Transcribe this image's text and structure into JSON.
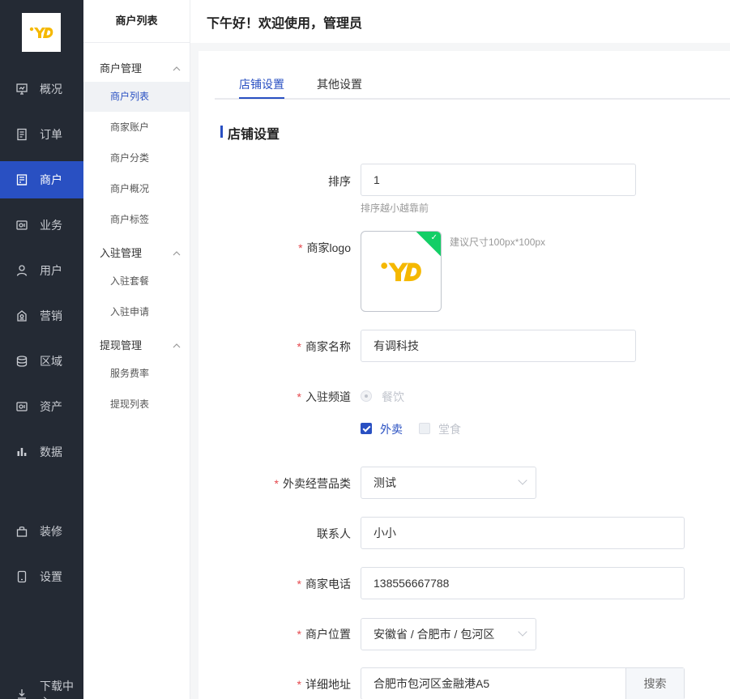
{
  "brand": {
    "logo_text": "YD",
    "accent": "#2950c2",
    "logo_color": "#f5b800"
  },
  "sidebar": {
    "items": [
      {
        "label": "概况",
        "icon": "dashboard-icon"
      },
      {
        "label": "订单",
        "icon": "order-icon"
      },
      {
        "label": "商户",
        "icon": "store-icon",
        "active": true
      },
      {
        "label": "业务",
        "icon": "business-icon"
      },
      {
        "label": "用户",
        "icon": "user-icon"
      },
      {
        "label": "营销",
        "icon": "marketing-icon"
      },
      {
        "label": "区域",
        "icon": "region-icon"
      },
      {
        "label": "资产",
        "icon": "asset-icon"
      },
      {
        "label": "数据",
        "icon": "data-icon"
      },
      {
        "label": "装修",
        "icon": "decoration-icon"
      },
      {
        "label": "设置",
        "icon": "settings-icon"
      }
    ],
    "bottom_partial": "下载中心"
  },
  "subbar": {
    "title": "商户列表",
    "groups": [
      {
        "title": "商户管理",
        "items": [
          "商户列表",
          "商家账户",
          "商户分类",
          "商户概况",
          "商户标签"
        ]
      },
      {
        "title": "入驻管理",
        "items": [
          "入驻套餐",
          "入驻申请"
        ]
      },
      {
        "title": "提现管理",
        "items": [
          "服务费率",
          "提现列表"
        ]
      }
    ],
    "active_item": "商户列表"
  },
  "header": {
    "greeting": "下午好！欢迎使用，管理员"
  },
  "tabs": [
    {
      "label": "店铺设置",
      "active": true
    },
    {
      "label": "其他设置"
    }
  ],
  "section_title": "店铺设置",
  "form": {
    "sort": {
      "label": "排序",
      "value": "1",
      "hint": "排序越小越靠前"
    },
    "logo": {
      "label": "商家logo",
      "hint": "建议尺寸100px*100px"
    },
    "name": {
      "label": "商家名称",
      "value": "有调科技"
    },
    "channel": {
      "label": "入驻频道",
      "radio": "餐饮",
      "checked": "外卖",
      "unchecked": "堂食"
    },
    "category": {
      "label": "外卖经营品类",
      "value": "测试"
    },
    "contact": {
      "label": "联系人",
      "value": "小小"
    },
    "phone": {
      "label": "商家电话",
      "value": "138556667788"
    },
    "location": {
      "label": "商户位置",
      "value": "安徽省 / 合肥市 / 包河区"
    },
    "address": {
      "label": "详细地址",
      "value": "合肥市包河区金融港A5",
      "button": "搜索"
    }
  }
}
